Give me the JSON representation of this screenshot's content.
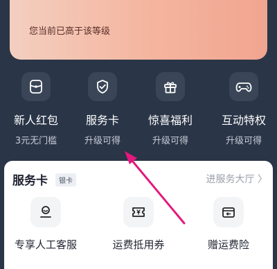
{
  "level_card": {
    "text": "您当前已高于该等级"
  },
  "benefits": [
    {
      "name": "新人红包",
      "sub": "3元无门槛",
      "icon": "wallet-icon"
    },
    {
      "name": "服务卡",
      "sub": "升级可得",
      "icon": "shield-check-icon"
    },
    {
      "name": "惊喜福利",
      "sub": "升级可得",
      "icon": "gift-icon"
    },
    {
      "name": "互动特权",
      "sub": "升级可得",
      "icon": "gamepad-icon"
    }
  ],
  "service_card": {
    "title": "服务卡",
    "badge": "银卡",
    "link": "进服务大厅 〉",
    "items": [
      {
        "label": "专享人工客服",
        "icon": "customer-service-icon"
      },
      {
        "label": "运费抵用券",
        "icon": "coupon-icon"
      },
      {
        "label": "赠运费险",
        "icon": "box-return-icon"
      }
    ]
  },
  "colors": {
    "background": "#2a3547",
    "card_gradient_start": "#f3cfc0",
    "card_gradient_end": "#f1a590",
    "arrow": "#e3197d"
  }
}
